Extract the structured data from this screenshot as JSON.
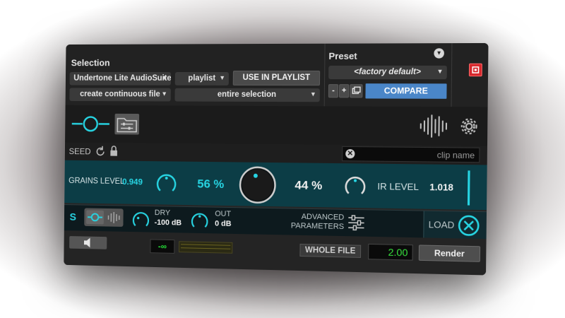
{
  "selection": {
    "title": "Selection",
    "plugin_dropdown": "Undertone Lite AudioSuite",
    "playlist_dropdown": "playlist",
    "use_in_playlist_button": "USE IN PLAYLIST",
    "mode_dropdown": "create continuous file",
    "range_dropdown": "entire selection"
  },
  "preset": {
    "title": "Preset",
    "preset_dropdown": "<factory default>",
    "minus_button": "-",
    "plus_button": "+",
    "compare_button": "COMPARE"
  },
  "seed": {
    "label": "SEED",
    "clip_name_placeholder": "clip name"
  },
  "controls": {
    "grains_level_label": "GRAINS LEVEL",
    "grains_level_value": "0.949",
    "grains_mix_value": "56 %",
    "ir_mix_value": "44 %",
    "ir_level_label": "IR LEVEL",
    "ir_level_value": "1.018"
  },
  "bottom": {
    "s_label": "S",
    "dry_label": "DRY",
    "dry_value": "-100 dB",
    "out_label": "OUT",
    "out_value": "0 dB",
    "advanced_label_line1": "ADVANCED",
    "advanced_label_line2": "PARAMETERS",
    "load_label": "LOAD"
  },
  "footer": {
    "meter_readout": "-∞",
    "whole_file_button": "WHOLE FILE",
    "handle_value": "2.00",
    "render_button": "Render"
  },
  "colors": {
    "accent_cyan": "#27d4e2",
    "compare_blue": "#4a86c8",
    "bypass_red": "#d6262b",
    "panel_teal": "#0c3d46"
  }
}
